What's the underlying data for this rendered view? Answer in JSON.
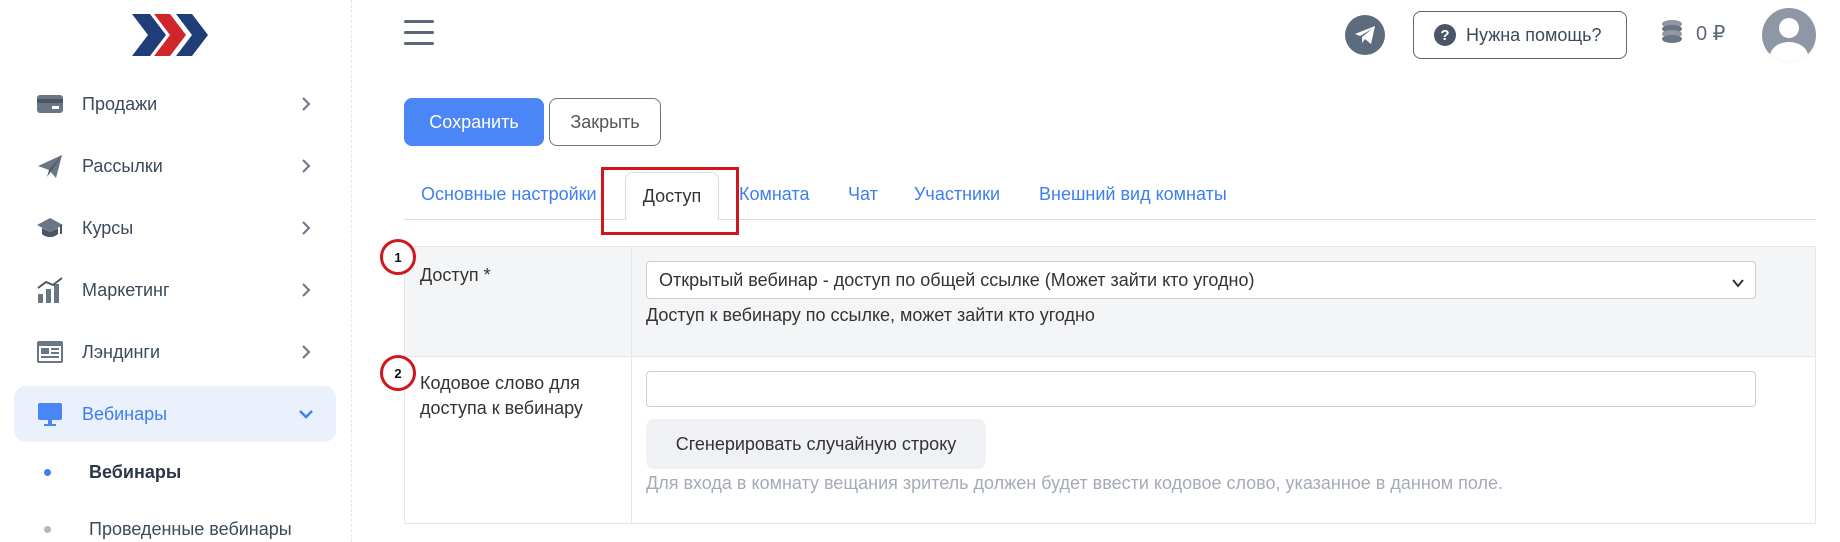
{
  "sidebar": {
    "items": [
      {
        "label": "Продажи",
        "icon": "card-icon"
      },
      {
        "label": "Рассылки",
        "icon": "paper-plane-icon"
      },
      {
        "label": "Курсы",
        "icon": "graduation-cap-icon"
      },
      {
        "label": "Маркетинг",
        "icon": "chart-icon"
      },
      {
        "label": "Лэндинги",
        "icon": "landing-page-icon"
      },
      {
        "label": "Вебинары",
        "icon": "monitor-icon"
      }
    ],
    "subitems": [
      {
        "label": "Вебинары"
      },
      {
        "label": "Проведенные вебинары"
      }
    ]
  },
  "header": {
    "help_label": "Нужна помощь?",
    "help_q": "?",
    "balance": "0 ₽"
  },
  "toolbar": {
    "save_label": "Сохранить",
    "close_label": "Закрыть"
  },
  "tabs": [
    {
      "label": "Основные настройки"
    },
    {
      "label": "Доступ"
    },
    {
      "label": "Комната"
    },
    {
      "label": "Чат"
    },
    {
      "label": "Участники"
    },
    {
      "label": "Внешний вид комнаты"
    }
  ],
  "form": {
    "access_label": "Доступ *",
    "access_value": "Открытый вебинар - доступ по общей ссылке (Может зайти кто угодно)",
    "access_hint": "Доступ к вебинару по ссылке, может зайти кто угодно",
    "codeword_label": "Кодовое слово для доступа к вебинару",
    "codeword_value": "",
    "generate_label": "Сгенерировать случайную строку",
    "codeword_hint": "Для входа в комнату вещания зритель должен будет ввести кодовое слово, указанное в данном поле."
  },
  "annotations": {
    "badge1": "1",
    "badge2": "2"
  },
  "colors": {
    "accent": "#4a86f5",
    "highlight": "#d0171d",
    "active_bg": "#eaf1fd"
  }
}
